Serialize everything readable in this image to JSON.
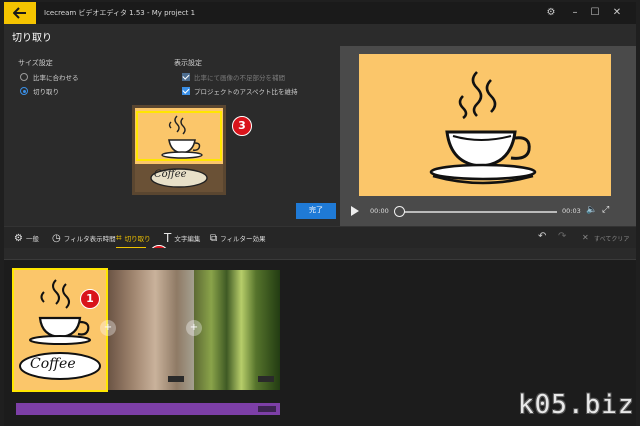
{
  "window": {
    "title": "Icecream ビデオエディタ 1.53 - My project 1",
    "back_icon": "arrow-left-icon",
    "accent": "#f5c400"
  },
  "header": {
    "title": "切り取り"
  },
  "size_settings": {
    "title": "サイズ設定",
    "options": [
      {
        "label": "比率に合わせる",
        "selected": false
      },
      {
        "label": "切り取り",
        "selected": true
      }
    ]
  },
  "display_settings": {
    "title": "表示設定",
    "options": [
      {
        "label": "比率にて画像の不足部分を補間",
        "checked": true,
        "disabled": true
      },
      {
        "label": "プロジェクトのアスペクト比を維持",
        "checked": true,
        "disabled": false
      }
    ]
  },
  "crop_thumbnail": {
    "caption": "Coffee",
    "marker": "3"
  },
  "done_button": {
    "label": "完了",
    "color": "#1f7ad6"
  },
  "player": {
    "current_time": "00:00",
    "duration": "00:03",
    "progress": 0,
    "background": "#fbc66a"
  },
  "toolbar": {
    "items": [
      {
        "label": "一般",
        "icon": "gear-icon"
      },
      {
        "label": "フィルタ表示時間",
        "icon": "clock-icon"
      },
      {
        "label": "切り取り",
        "icon": "crop-icon",
        "active": true
      },
      {
        "label": "文字編集",
        "icon": "text-icon"
      },
      {
        "label": "フィルター効果",
        "icon": "filter-icon"
      }
    ],
    "clear_all": "すべてクリア",
    "marker": "2"
  },
  "timeline": {
    "clips": [
      {
        "caption": "Coffee",
        "marker": "1",
        "selected": true
      },
      {
        "thumbnail": "brown-blur"
      },
      {
        "thumbnail": "forest"
      }
    ]
  },
  "watermark": "k05.biz"
}
